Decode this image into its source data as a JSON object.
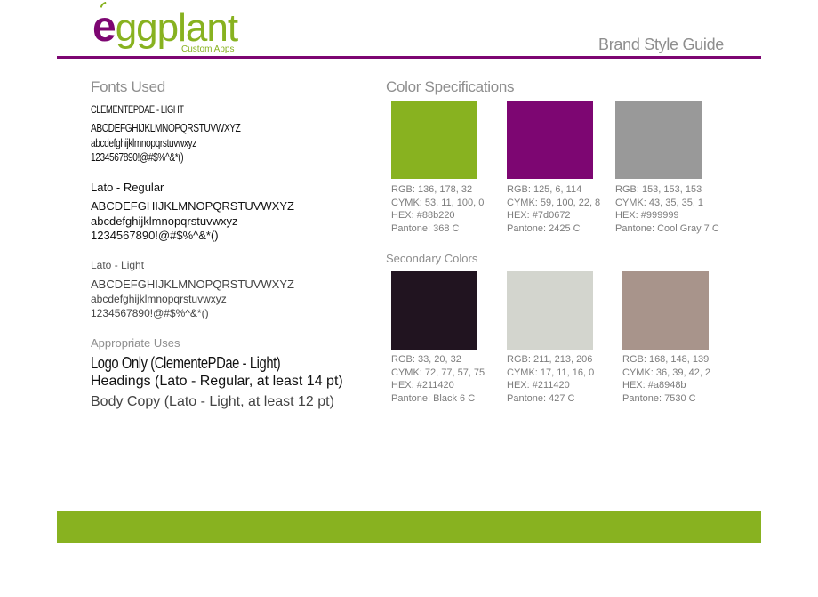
{
  "header": {
    "logo_e": "e",
    "logo_rest": "ggplant",
    "logo_sub": "Custom Apps",
    "title": "Brand Style Guide"
  },
  "fonts": {
    "section_title": "Fonts Used",
    "clemente": {
      "name": "CLEMENTEPDAE - LIGHT",
      "upper": "ABCDEFGHIJKLMNOPQRSTUVWXYZ",
      "lower": "abcdefghijklmnopqrstuvwxyz",
      "nums": "1234567890!@#$%^&*()"
    },
    "lato_regular": {
      "name": "Lato - Regular",
      "upper": "ABCDEFGHIJKLMNOPQRSTUVWXYZ",
      "lower": "abcdefghijklmnopqrstuvwxyz",
      "nums": "1234567890!@#$%^&*()"
    },
    "lato_light": {
      "name": "Lato - Light",
      "upper": "ABCDEFGHIJKLMNOPQRSTUVWXYZ",
      "lower": "abcdefghijklmnopqrstuvwxyz",
      "nums": "1234567890!@#$%^&*()"
    },
    "uses_title": "Appropriate Uses",
    "uses": [
      "Logo Only (ClementePDae - Light)",
      "Headings (Lato - Regular, at least 14 pt)",
      "Body Copy (Lato - Light, at least 12 pt)"
    ]
  },
  "colors": {
    "section_title": "Color Specifications",
    "primary": [
      {
        "hex_color": "#88b220",
        "rgb": "RGB: 136, 178, 32",
        "cymk": "CYMK: 53, 11, 100, 0",
        "hex": "HEX: #88b220",
        "pantone": "Pantone: 368 C"
      },
      {
        "hex_color": "#7d0672",
        "rgb": "RGB: 125, 6, 114",
        "cymk": "CYMK: 59, 100, 22, 8",
        "hex": "HEX: #7d0672",
        "pantone": "Pantone: 2425 C"
      },
      {
        "hex_color": "#999999",
        "rgb": "RGB: 153, 153, 153",
        "cymk": "CYMK: 43, 35, 35, 1",
        "hex": "HEX: #999999",
        "pantone": "Pantone: Cool Gray 7 C"
      }
    ],
    "secondary_title": "Secondary Colors",
    "secondary": [
      {
        "hex_color": "#211420",
        "rgb": "RGB: 33, 20, 32",
        "cymk": "CYMK: 72, 77, 57, 75",
        "hex": "HEX: #211420",
        "pantone": "Pantone: Black 6 C"
      },
      {
        "hex_color": "#d3d5ce",
        "rgb": "RGB: 211, 213, 206",
        "cymk": "CYMK: 17, 11, 16, 0",
        "hex": "HEX: #211420",
        "pantone": "Pantone: 427 C"
      },
      {
        "hex_color": "#a8948b",
        "rgb": "RGB: 168, 148, 139",
        "cymk": "CYMK: 36, 39, 42, 2",
        "hex": "HEX: #a8948b",
        "pantone": "Pantone: 7530 C"
      }
    ]
  },
  "footer": {
    "bar_color": "#88b220"
  }
}
